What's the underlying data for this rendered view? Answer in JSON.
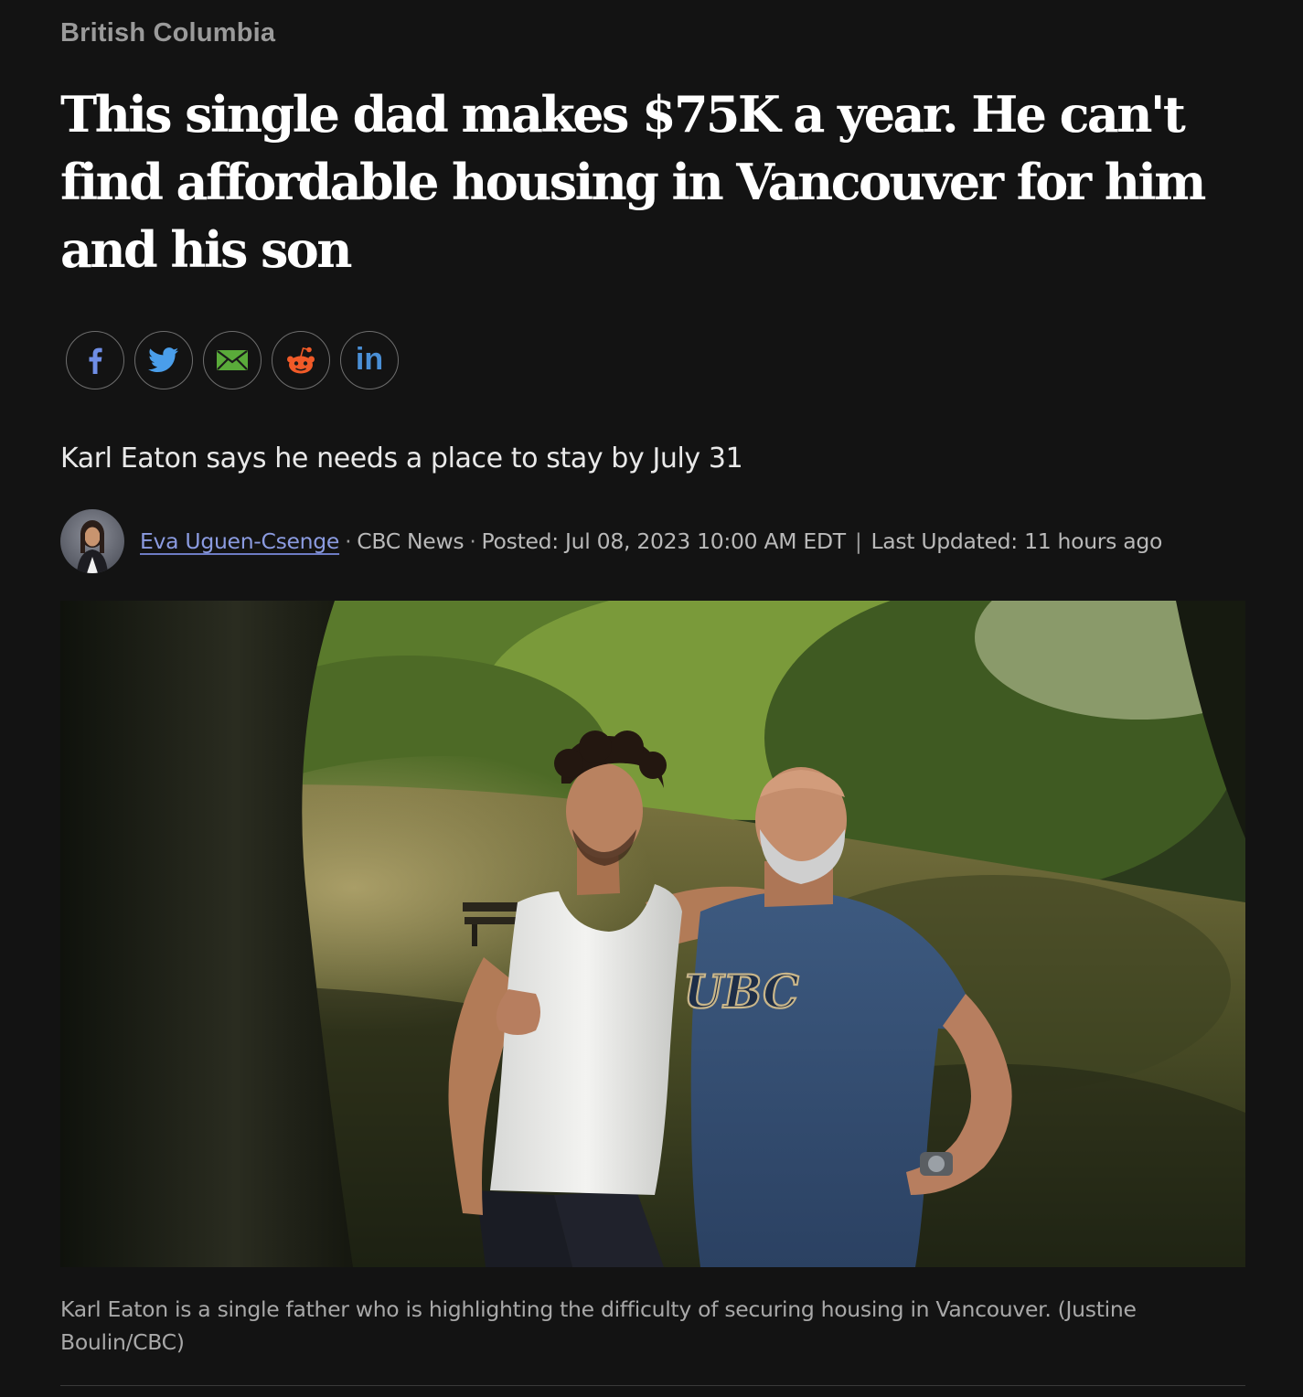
{
  "section": {
    "label": "British Columbia"
  },
  "headline": "This single dad makes $75K a year. He can't find affordable housing in Vancouver for him and his son",
  "share": {
    "icons": [
      "facebook-icon",
      "twitter-icon",
      "email-icon",
      "reddit-icon",
      "linkedin-icon"
    ],
    "linkedin_text": "in",
    "colors": {
      "facebook": "#6f8ee6",
      "twitter": "#4a9eea",
      "email": "#5aab3a",
      "reddit": "#f05a28",
      "linkedin": "#4a8fd6"
    }
  },
  "deck": "Karl Eaton says he needs a place to stay by July 31",
  "byline": {
    "author": "Eva Uguen-Csenge",
    "dot1": "·",
    "outlet": "CBC News",
    "dot2": "·",
    "posted": "Posted: Jul 08, 2023 10:00 AM EDT",
    "pipe": "|",
    "updated": "Last Updated: 11 hours ago"
  },
  "photo": {
    "shirt_text": "UBC"
  },
  "caption": "Karl Eaton is a single father who is highlighting the difficulty of securing housing in Vancouver. (Justine Boulin/CBC)",
  "colors": {
    "background": "#131313",
    "headline": "#ffffff",
    "link": "#8b9be0",
    "muted": "#a8a8a8"
  }
}
